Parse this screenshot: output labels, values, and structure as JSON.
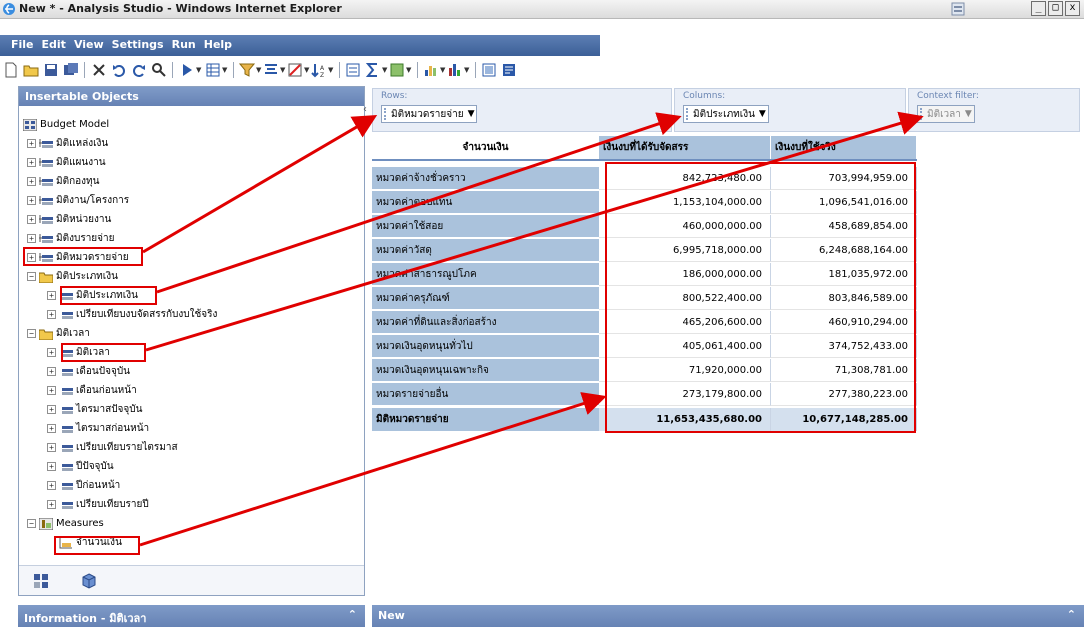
{
  "window": {
    "title": "New * - Analysis Studio - Windows Internet Explorer",
    "controls": [
      "_",
      "□",
      "x"
    ]
  },
  "menu": [
    "File",
    "Edit",
    "View",
    "Settings",
    "Run",
    "Help"
  ],
  "left_panel": {
    "title": "Insertable Objects",
    "root": "Budget Model",
    "items": [
      "มิติแหล่งเงิน",
      "มิติแผนงาน",
      "มิติกองทุน",
      "มิติงาน/โครงการ",
      "มิติหน่วยงาน",
      "มิติงบรายจ่าย",
      "มิติหมวดรายจ่าย",
      "มิติประเภทเงิน",
      "มิติประเภทเงิน",
      "เปรียบเทียบงบจัดสรรกับงบใช้จริง",
      "มิติเวลา",
      "มิติเวลา",
      "เดือนปัจจุบัน",
      "เดือนก่อนหน้า",
      "ไตรมาสปัจจุบัน",
      "ไตรมาสก่อนหน้า",
      "เปรียบเทียบรายไตรมาส",
      "ปีปัจจุบัน",
      "ปีก่อนหน้า",
      "เปรียบเทียบรายปี",
      "Measures",
      "จำนวนเงิน"
    ]
  },
  "drop_zones": {
    "rows": {
      "label": "Rows:",
      "value": "มิติหมวดรายจ่าย"
    },
    "columns": {
      "label": "Columns:",
      "value": "มิติประเภทเงิน"
    },
    "context": {
      "label": "Context filter:",
      "value": "มิติเวลา"
    }
  },
  "crosstab": {
    "measure": "จำนวนเงิน",
    "columns": [
      "เงินงบที่ได้รับจัดสรร",
      "เงินงบที่ใช้จริง"
    ],
    "rows": [
      {
        "label": "หมวดค่าจ้างชั่วคราว",
        "v1": "842,723,480.00",
        "v2": "703,994,959.00"
      },
      {
        "label": "หมวดค่าตอบแทน",
        "v1": "1,153,104,000.00",
        "v2": "1,096,541,016.00"
      },
      {
        "label": "หมวดค่าใช้สอย",
        "v1": "460,000,000.00",
        "v2": "458,689,854.00"
      },
      {
        "label": "หมวดค่าวัสดุ",
        "v1": "6,995,718,000.00",
        "v2": "6,248,688,164.00"
      },
      {
        "label": "หมวดค่าสาธารณูปโภค",
        "v1": "186,000,000.00",
        "v2": "181,035,972.00"
      },
      {
        "label": "หมวดค่าครุภัณฑ์",
        "v1": "800,522,400.00",
        "v2": "803,846,589.00"
      },
      {
        "label": "หมวดค่าที่ดินและสิ่งก่อสร้าง",
        "v1": "465,206,600.00",
        "v2": "460,910,294.00"
      },
      {
        "label": "หมวดเงินอุดหนุนทั่วไป",
        "v1": "405,061,400.00",
        "v2": "374,752,433.00"
      },
      {
        "label": "หมวดเงินอุดหนุนเฉพาะกิจ",
        "v1": "71,920,000.00",
        "v2": "71,308,781.00"
      },
      {
        "label": "หมวดรายจ่ายอื่น",
        "v1": "273,179,800.00",
        "v2": "277,380,223.00"
      }
    ],
    "total": {
      "label": "มิติหมวดรายจ่าย",
      "v1": "11,653,435,680.00",
      "v2": "10,677,148,285.00"
    }
  },
  "bottom": {
    "info": "Information - มิติเวลา",
    "new": "New"
  },
  "colors": {
    "header_blue": "#6682b4",
    "crosstab_header": "#aac2dc",
    "annotation_red": "#e00000",
    "menu_blue": "#3b5f97"
  }
}
